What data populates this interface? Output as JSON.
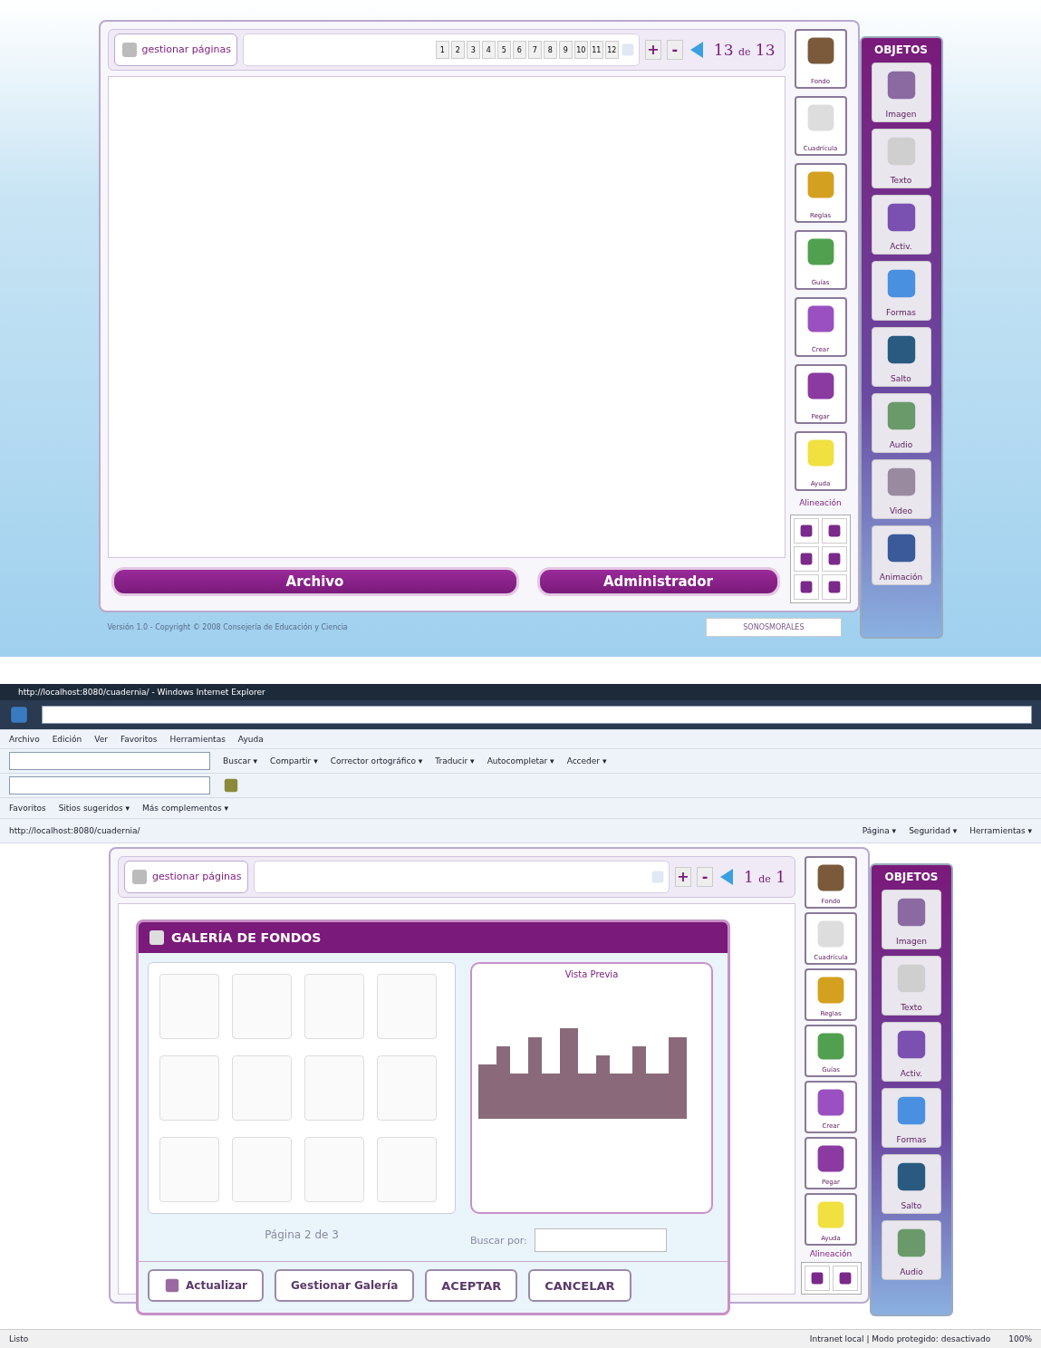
{
  "editor": {
    "manage_button": "gestionar páginas",
    "page_numbers": [
      "1",
      "2",
      "3",
      "4",
      "5",
      "6",
      "7",
      "8",
      "9",
      "10",
      "11",
      "12"
    ],
    "add": "+",
    "remove": "-",
    "current_page": "13",
    "of": "de",
    "total_pages": "13",
    "tools": [
      {
        "label": "Fondo"
      },
      {
        "label": "Cuadrícula"
      },
      {
        "label": "Reglas"
      },
      {
        "label": "Guías"
      },
      {
        "label": "Crear"
      },
      {
        "label": "Pegar"
      },
      {
        "label": "Ayuda"
      }
    ],
    "alignment_title": "Alineación",
    "objects_title": "OBJETOS",
    "objects": [
      {
        "label": "Imagen"
      },
      {
        "label": "Texto"
      },
      {
        "label": "Activ."
      },
      {
        "label": "Formas"
      },
      {
        "label": "Salto"
      },
      {
        "label": "Audio"
      },
      {
        "label": "Video"
      },
      {
        "label": "Animación"
      }
    ],
    "footer_buttons": [
      "Archivo",
      "Administrador"
    ],
    "version": "Versión 1.0 - Copyright © 2008 Consejería de Educación y Ciencia",
    "credit": "SONOSMORALES"
  },
  "browser": {
    "title": "http://localhost:8080/cuadernia/ - Windows Internet Explorer",
    "menu": [
      "Archivo",
      "Edición",
      "Ver",
      "Favoritos",
      "Herramientas",
      "Ayuda"
    ],
    "toolbar": [
      "Buscar ▾",
      "Compartir ▾",
      "Corrector ortográfico ▾",
      "Traducir ▾",
      "Autocompletar ▾",
      "Acceder ▾"
    ],
    "favorites": [
      "Favoritos",
      "Sitios sugeridos ▾",
      "Más complementos ▾"
    ],
    "tab": "http://localhost:8080/cuadernia/",
    "commands": [
      "Página ▾",
      "Seguridad ▾",
      "Herramientas ▾"
    ],
    "status": "Listo",
    "zone": "Intranet local | Modo protegido: desactivado",
    "zoom": "100%"
  },
  "app2": {
    "manage_button": "gestionar páginas",
    "add": "+",
    "remove": "-",
    "current_page": "1",
    "of": "de",
    "total_pages": "1",
    "tools": [
      {
        "label": "Fondo"
      },
      {
        "label": "Cuadrícula"
      },
      {
        "label": "Reglas"
      },
      {
        "label": "Guías"
      },
      {
        "label": "Crear"
      },
      {
        "label": "Pegar"
      },
      {
        "label": "Ayuda"
      }
    ],
    "alignment_title": "Alineación",
    "objects_title": "OBJETOS",
    "objects": [
      {
        "label": "Imagen"
      },
      {
        "label": "Texto"
      },
      {
        "label": "Activ."
      },
      {
        "label": "Formas"
      },
      {
        "label": "Salto"
      },
      {
        "label": "Audio"
      }
    ]
  },
  "gallery": {
    "title": "GALERÍA DE FONDOS",
    "preview_title": "Vista Previa",
    "pager": "Página 2 de 3",
    "search_label": "Buscar por:",
    "buttons": [
      {
        "label": "Actualizar",
        "kind": "icon"
      },
      {
        "label": "Gestionar Galería",
        "kind": "plain"
      },
      {
        "label": "ACEPTAR",
        "kind": "bold"
      },
      {
        "label": "CANCELAR",
        "kind": "bold"
      }
    ]
  }
}
